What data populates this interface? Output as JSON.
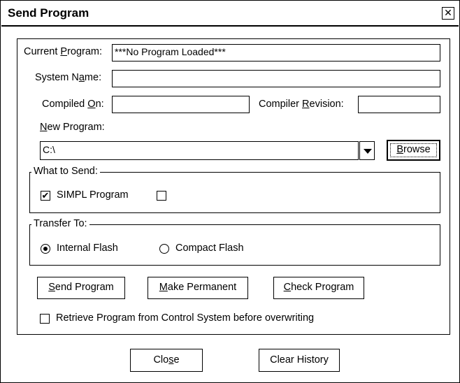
{
  "window": {
    "title": "Send Program",
    "close_glyph": "✕"
  },
  "fields": {
    "current_program_label_pre": "Current ",
    "current_program_label_key": "P",
    "current_program_label_post": "rogram:",
    "current_program_value": "***No Program Loaded***",
    "system_name_label_pre": "System N",
    "system_name_label_key": "a",
    "system_name_label_post": "me:",
    "system_name_value": "",
    "compiled_on_label_pre": "Compiled ",
    "compiled_on_label_key": "O",
    "compiled_on_label_post": "n:",
    "compiled_on_value": "",
    "compiler_revision_label_pre": "Compiler ",
    "compiler_revision_label_key": "R",
    "compiler_revision_label_post": "evision:",
    "compiler_revision_value": "",
    "new_program_label_key": "N",
    "new_program_label_post": "ew Program:",
    "new_program_value": "C:\\",
    "browse_key": "B",
    "browse_post": "rowse"
  },
  "what_to_send": {
    "legend": "What to Send:",
    "simpl_program_label": "SIMPL Program",
    "simpl_program_checked": true,
    "check_mark": "✔",
    "second_checked": false
  },
  "transfer_to": {
    "legend": "Transfer To:",
    "options": [
      {
        "label": "Internal Flash",
        "selected": true
      },
      {
        "label": "Compact Flash",
        "selected": false
      }
    ]
  },
  "actions": {
    "send_key": "S",
    "send_post": "end Program",
    "permanent_key": "M",
    "permanent_post": "ake Permanent",
    "check_key": "C",
    "check_post": "heck Program"
  },
  "retrieve": {
    "label": "Retrieve Program from Control System before overwriting",
    "checked": false
  },
  "footer": {
    "close_pre": "Clo",
    "close_key": "s",
    "close_post": "e",
    "clear_history": "Clear History"
  }
}
